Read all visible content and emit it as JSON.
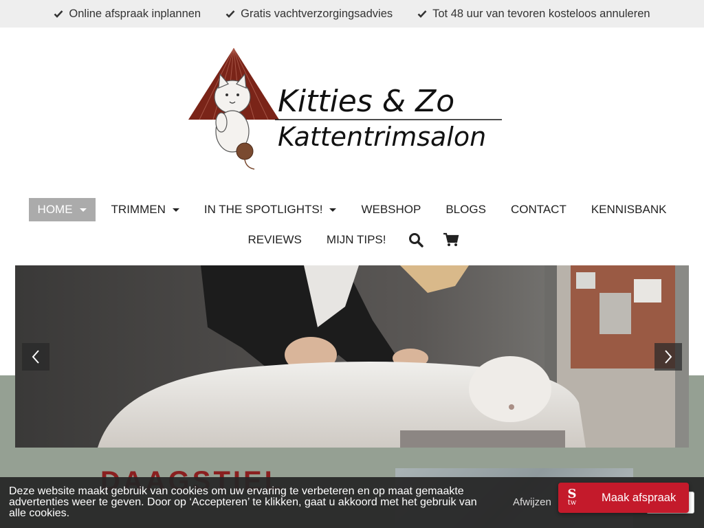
{
  "usp": [
    {
      "label": "Online afspraak inplannen",
      "icon": "check-icon"
    },
    {
      "label": "Gratis vachtverzorgingsadvies",
      "icon": "check-icon"
    },
    {
      "label": "Tot 48 uur van tevoren kosteloos annuleren",
      "icon": "check-icon"
    }
  ],
  "logo": {
    "line1": "Kitties & Zo",
    "line2": "Kattentrimsalon"
  },
  "nav": {
    "items": [
      {
        "label": "HOME",
        "active": true,
        "has_dropdown": true
      },
      {
        "label": "TRIMMEN",
        "has_dropdown": true
      },
      {
        "label": "IN THE SPOTLIGHTS!",
        "has_dropdown": true
      },
      {
        "label": "WEBSHOP"
      },
      {
        "label": "BLOGS"
      },
      {
        "label": "CONTACT"
      },
      {
        "label": "KENNISBANK"
      },
      {
        "label": "REVIEWS"
      },
      {
        "label": "MIJN TIPS!"
      }
    ],
    "search_icon": "search-icon",
    "cart_icon": "cart-icon"
  },
  "hero": {
    "prev_icon": "chevron-left-icon",
    "next_icon": "chevron-right-icon"
  },
  "content": {
    "heading_partial": "DAAGSTIEL"
  },
  "cookie": {
    "text": "Deze website maakt gebruik van cookies om uw ervaring te verbeteren en op maat gemaakte advertenties weer te geven. Door op ‘Accepteren’ te klikken, gaat u akkoord met het gebruik van alle cookies.",
    "decline_label": "Afwijzen"
  },
  "booking": {
    "logo_s": "S",
    "logo_tw": "tw",
    "label": "Maak afspraak"
  },
  "colors": {
    "accent": "#c41a2b",
    "band": "#95a093",
    "nav_active": "#ababab"
  }
}
